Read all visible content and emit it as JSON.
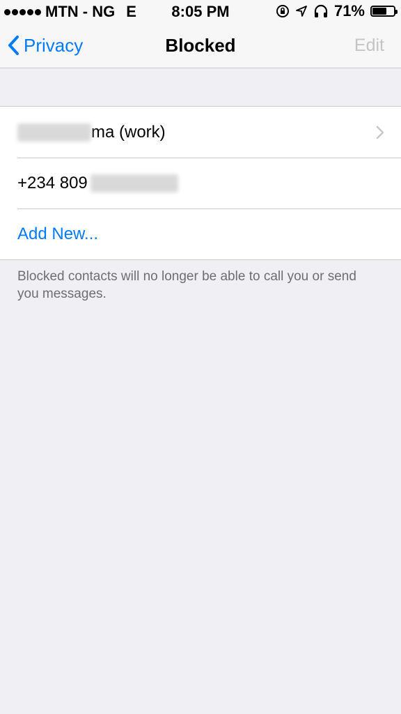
{
  "status_bar": {
    "carrier": "MTN - NG",
    "network": "E",
    "time": "8:05 PM",
    "battery": "71%",
    "battery_level": 0.71
  },
  "nav": {
    "back_label": "Privacy",
    "title": "Blocked",
    "edit_label": "Edit"
  },
  "blocked_list": {
    "contact_1_suffix": "ma (work)",
    "contact_2_prefix": "+234 809",
    "add_new_label": "Add New..."
  },
  "footer": {
    "text": "Blocked contacts will no longer be able to call you or send you messages."
  },
  "colors": {
    "accent": "#007aff",
    "background": "#efeff4",
    "disabled": "#c4c4c6"
  }
}
